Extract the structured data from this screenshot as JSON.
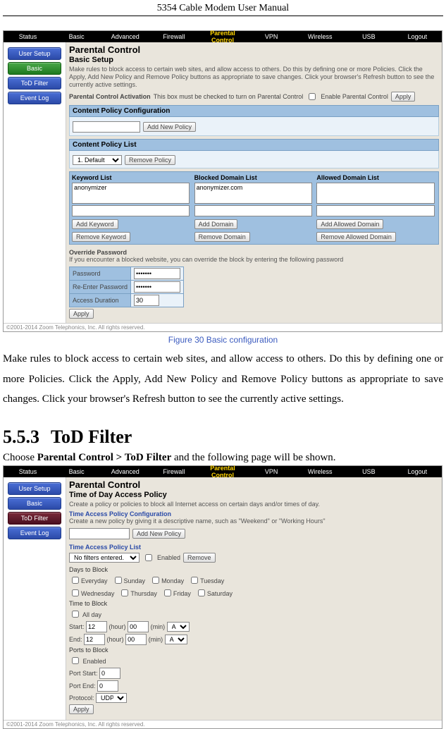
{
  "page_header": "5354 Cable Modem User Manual",
  "caption1": "Figure 30 Basic configuration",
  "body1": "Make rules to block access to certain web sites, and allow access to others. Do this by defining one or more Policies. Click the Apply, Add New Policy and Remove Policy buttons as appropriate to save changes. Click your browser's Refresh button to see the currently active settings.",
  "section_number": "5.5.3",
  "section_title": "ToD Filter",
  "nav_pre": "Choose ",
  "nav_bold": "Parental Control > ToD Filter",
  "nav_post": " and the following page will be shown.",
  "nav": {
    "tabs": [
      "Status",
      "Basic",
      "Advanced",
      "Firewall",
      "Parental Control",
      "VPN",
      "Wireless",
      "USB",
      "Logout"
    ],
    "active_index": 4
  },
  "sidebar": {
    "user_setup": "User Setup",
    "basic": "Basic",
    "tod": "ToD Filter",
    "event_log": "Event Log"
  },
  "shot1": {
    "title": "Parental Control",
    "subtitle": "Basic Setup",
    "blurb": "Make rules to block access to certain web sites, and allow access to others. Do this by defining one or more Policies. Click the Apply, Add New Policy and Remove Policy buttons as appropriate to save changes. Click your browser's Refresh button to see the currently active settings.",
    "activation_label": "Parental Control Activation",
    "activation_desc": "This box must be checked to turn on Parental Control",
    "enable_label": "Enable Parental Control",
    "apply": "Apply",
    "policy_head": "Content Policy Configuration",
    "add_new_policy": "Add New Policy",
    "policy_list_head": "Content Policy List",
    "policy_default": "1. Default",
    "remove_policy": "Remove Policy",
    "col_keyword": "Keyword List",
    "col_blocked": "Blocked Domain List",
    "col_allowed": "Allowed Domain List",
    "kw_sample": "anonymizer",
    "bd_sample": "anonymizer.com",
    "add_keyword": "Add Keyword",
    "remove_keyword": "Remove Keyword",
    "add_domain": "Add Domain",
    "remove_domain": "Remove Domain",
    "add_allowed": "Add Allowed Domain",
    "remove_allowed": "Remove Allowed Domain",
    "override_head": "Override Password",
    "override_desc": "If you encounter a blocked website, you can override the block by entering the following password",
    "pw_label": "Password",
    "pw2_label": "Re-Enter Password",
    "dur_label": "Access Duration",
    "dur_value": "30",
    "pw_mask": "•••••••",
    "copyright": "©2001-2014 Zoom Telephonics, Inc. All rights reserved."
  },
  "shot2": {
    "title": "Parental Control",
    "subtitle": "Time of Day Access Policy",
    "blurb": "Create a policy or policies to block all Internet access on certain days and/or times of day.",
    "config_head": "Time Access Policy Configuration",
    "config_desc": "Create a new policy by giving it a descriptive name, such as \"Weekend\" or \"Working Hours\"",
    "add_new_policy": "Add New Policy",
    "list_head": "Time Access Policy List",
    "list_select": "No filters entered.",
    "enabled": "Enabled",
    "remove": "Remove",
    "days_label": "Days to Block",
    "days": [
      "Everyday",
      "Sunday",
      "Monday",
      "Tuesday",
      "Wednesday",
      "Thursday",
      "Friday",
      "Saturday"
    ],
    "time_label": "Time to Block",
    "all_day": "All day",
    "start": "Start:",
    "end": "End:",
    "hour": "(hour)",
    "min": "(min)",
    "sv_start_h": "12",
    "sv_start_m": "00",
    "sv_end_h": "12",
    "sv_end_m": "00",
    "ampm": "AM",
    "ports_label": "Ports to Block",
    "port_start": "Port Start:",
    "port_end": "Port End:",
    "pv_start": "0",
    "pv_end": "0",
    "protocol": "Protocol:",
    "protocol_v": "UDP",
    "apply": "Apply",
    "copyright": "©2001-2014 Zoom Telephonics, Inc. All rights reserved."
  }
}
